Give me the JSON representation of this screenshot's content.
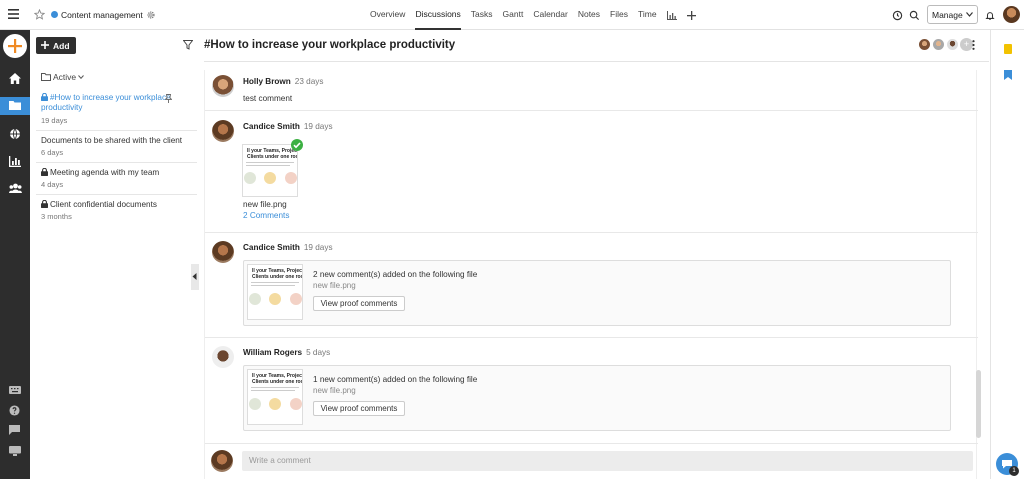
{
  "project": {
    "name": "Content management"
  },
  "tabs": [
    {
      "label": "Overview",
      "active": false
    },
    {
      "label": "Discussions",
      "active": true
    },
    {
      "label": "Tasks",
      "active": false
    },
    {
      "label": "Gantt",
      "active": false
    },
    {
      "label": "Calendar",
      "active": false
    },
    {
      "label": "Notes",
      "active": false
    },
    {
      "label": "Files",
      "active": false
    },
    {
      "label": "Time",
      "active": false
    }
  ],
  "header": {
    "manage_label": "Manage"
  },
  "sidebar": {
    "add_label": "Add",
    "filter_label": "Active",
    "items": [
      {
        "title": "#How to increase your workplace productivity",
        "age": "19 days",
        "locked": true,
        "selected": true
      },
      {
        "title": "Documents to be shared with the client",
        "age": "6 days",
        "locked": false,
        "selected": false
      },
      {
        "title": "Meeting agenda with my team",
        "age": "4 days",
        "locked": true,
        "selected": false
      },
      {
        "title": "Client confidential documents",
        "age": "3 months",
        "locked": true,
        "selected": false
      }
    ]
  },
  "discussion": {
    "title": "#How to increase your workplace productivity",
    "comments": [
      {
        "author": "Holly Brown",
        "age": "23 days",
        "text": "test comment"
      },
      {
        "author": "Candice Smith",
        "age": "19 days",
        "file_name": "new file.png",
        "link": "2 Comments"
      },
      {
        "author": "Candice Smith",
        "age": "19 days",
        "message": "2 new comment(s) added on the following file",
        "file_name": "new file.png",
        "button": "View proof comments"
      },
      {
        "author": "William Rogers",
        "age": "5 days",
        "message": "1 new comment(s) added on the following file",
        "file_name": "new file.png",
        "button": "View proof comments"
      }
    ],
    "thumbnail_text": "ll your Teams, Projects an\nClients under one roof!",
    "compose_placeholder": "Write a comment"
  },
  "chat": {
    "badge": "1"
  },
  "colors": {
    "accent": "#3b8ed8",
    "rail": "#2d2d2d",
    "add_orange": "#f08a24",
    "check": "#3cb043"
  }
}
